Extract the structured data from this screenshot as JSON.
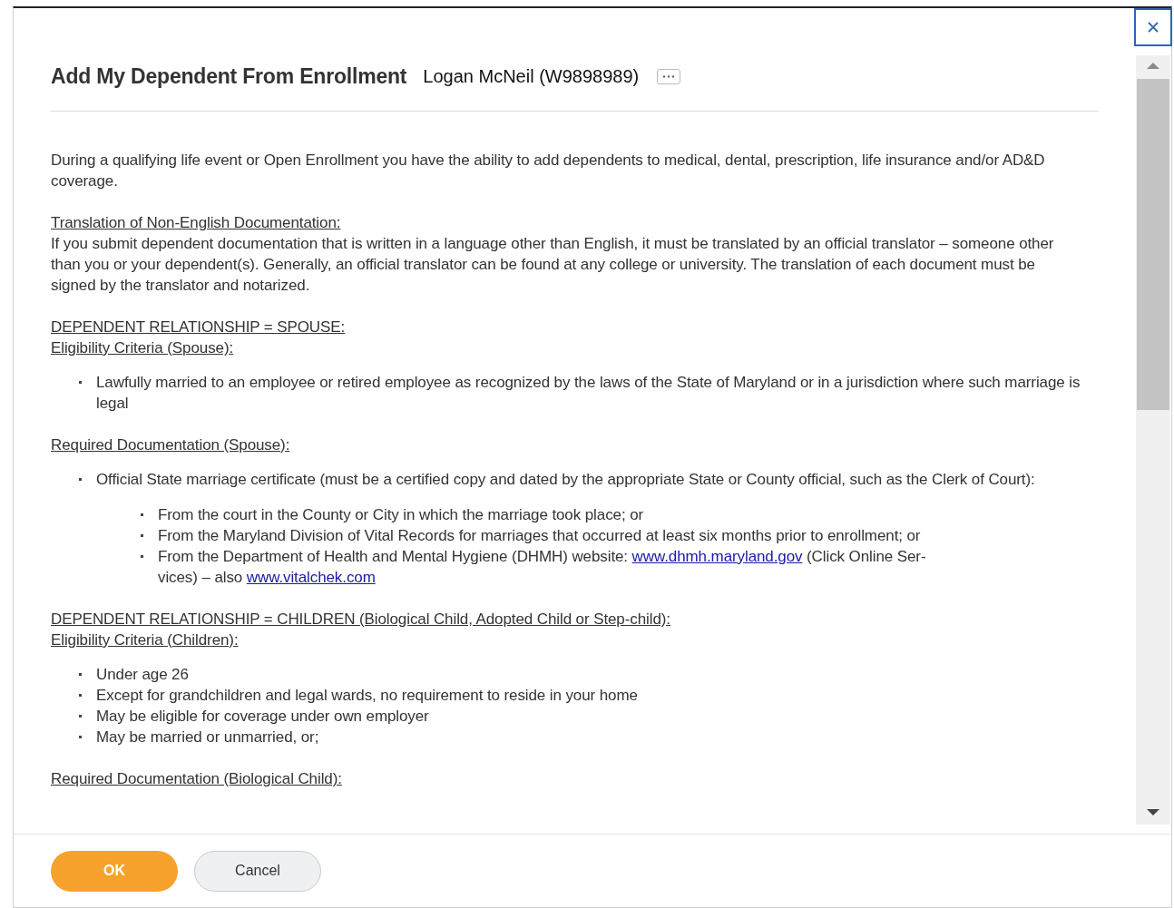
{
  "dialog": {
    "title": "Add My Dependent From Enrollment",
    "subtitle": "Logan McNeil (W9898989)"
  },
  "content": [
    {
      "kind": "paragraph",
      "parts": [
        {
          "kind": "text",
          "text": "During a qualifying life event or Open Enrollment you have the ability to add dependents to medical, dental, prescription, life insurance and/or AD&D coverage."
        }
      ]
    },
    {
      "kind": "heading",
      "parts": [
        {
          "kind": "text",
          "text": "Translation of Non-English Documentation:"
        }
      ]
    },
    {
      "kind": "paragraph",
      "parts": [
        {
          "kind": "text",
          "text": "If you submit dependent documentation that is written in a language other than English, it must be translated by an official translator – someone other than you or your dependent(s).  Generally, an official translator can be found at any college or university. The translation of each document must be signed by the translator and notarized."
        }
      ]
    },
    {
      "kind": "heading",
      "parts": [
        {
          "kind": "text",
          "text": "DEPENDENT RELATIONSHIP = SPOUSE:"
        }
      ]
    },
    {
      "kind": "heading",
      "parts": [
        {
          "kind": "text",
          "text": "Eligibility Criteria (Spouse):"
        }
      ]
    },
    {
      "kind": "list",
      "items": [
        {
          "parts": [
            {
              "kind": "text",
              "text": "Lawfully married to an employee or retired employee as recognized by the laws of the State of Maryland or in a jurisdiction where such marriage is legal"
            }
          ]
        }
      ]
    },
    {
      "kind": "heading",
      "parts": [
        {
          "kind": "text",
          "text": "Required Documentation (Spouse):"
        }
      ]
    },
    {
      "kind": "list",
      "items": [
        {
          "parts": [
            {
              "kind": "text",
              "text": "Official State marriage certificate (must be a certified copy and dated by the appropriate State or County official, such as the Clerk of Court):"
            }
          ],
          "children": [
            {
              "parts": [
                {
                  "kind": "text",
                  "text": "From the court in the County or City in which the marriage took place; or"
                }
              ]
            },
            {
              "parts": [
                {
                  "kind": "text",
                  "text": "From the Maryland Division of Vital Records for marriages that occurred at least six months prior to enrollment; or"
                }
              ]
            },
            {
              "parts": [
                {
                  "kind": "text",
                  "text": "From the Department of Health and Mental Hygiene (DHMH) website:  "
                },
                {
                  "kind": "link",
                  "text": "www.dhmh.maryland.gov"
                },
                {
                  "kind": "text",
                  "text": " (Click Online Ser-\nvices) – also "
                },
                {
                  "kind": "link",
                  "text": "www.vitalchek.com"
                }
              ]
            }
          ]
        }
      ]
    },
    {
      "kind": "heading",
      "parts": [
        {
          "kind": "text",
          "text": "DEPENDENT RELATIONSHIP = CHILDREN (Biological Child, Adopted Child or Step-child):"
        }
      ]
    },
    {
      "kind": "heading",
      "parts": [
        {
          "kind": "text",
          "text": "Eligibility Criteria (Children):"
        }
      ]
    },
    {
      "kind": "list",
      "items": [
        {
          "parts": [
            {
              "kind": "text",
              "text": "Under age 26"
            }
          ]
        },
        {
          "parts": [
            {
              "kind": "text",
              "text": "Except for grandchildren and legal wards, no requirement to reside in your home"
            }
          ]
        },
        {
          "parts": [
            {
              "kind": "text",
              "text": "May be eligible for coverage under own employer"
            }
          ]
        },
        {
          "parts": [
            {
              "kind": "text",
              "text": "May be married or unmarried, or;"
            }
          ]
        }
      ]
    },
    {
      "kind": "heading",
      "parts": [
        {
          "kind": "text",
          "text": "Required Documentation (Biological Child):"
        }
      ]
    }
  ],
  "buttons": [
    {
      "label": "OK",
      "kind": "primary"
    },
    {
      "label": "Cancel",
      "kind": "secondary"
    }
  ]
}
